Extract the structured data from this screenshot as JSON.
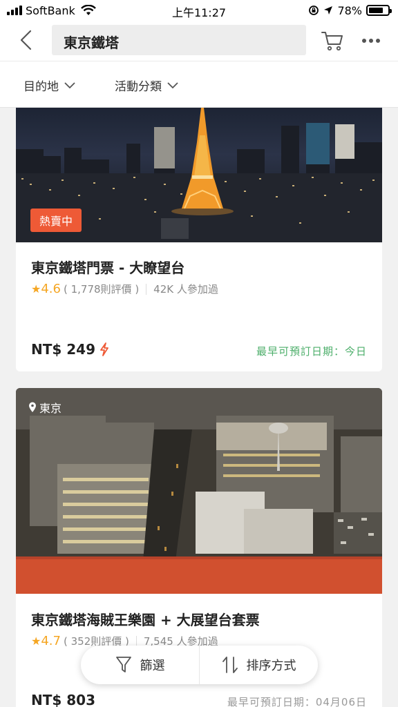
{
  "status_bar": {
    "carrier": "SoftBank",
    "time": "上午11:27",
    "battery": "78%",
    "battery_level": 0.78,
    "icons": [
      "signal-icon",
      "wifi-icon",
      "screen-lock-icon",
      "location-arrow-icon",
      "battery-icon"
    ]
  },
  "header": {
    "search_value": "東京鐵塔",
    "icons": [
      "back-icon",
      "cart-icon",
      "more-icon"
    ]
  },
  "filters": [
    {
      "label": "目的地"
    },
    {
      "label": "活動分類"
    }
  ],
  "cards": [
    {
      "badge": "熱賣中",
      "title": "東京鐵塔門票 - 大瞭望台",
      "rating": "4.6",
      "reviews": "( 1,778則評價 )",
      "participants": "42K 人參加過",
      "price": "NT$ 249",
      "availability": "最早可預訂日期：今日"
    },
    {
      "location": "東京",
      "title": "東京鐵塔海賊王樂園 + 大展望台套票",
      "rating": "4.7",
      "reviews": "( 352則評價 )",
      "participants": "7,545 人參加過",
      "price": "NT$ 803",
      "availability": "最早可預訂日期：04月06日"
    }
  ],
  "bottom_bar": {
    "filter_label": "篩選",
    "sort_label": "排序方式"
  },
  "colors": {
    "accent": "#ee5a36",
    "rating": "#f5a623",
    "available_green": "#4cae6a"
  }
}
